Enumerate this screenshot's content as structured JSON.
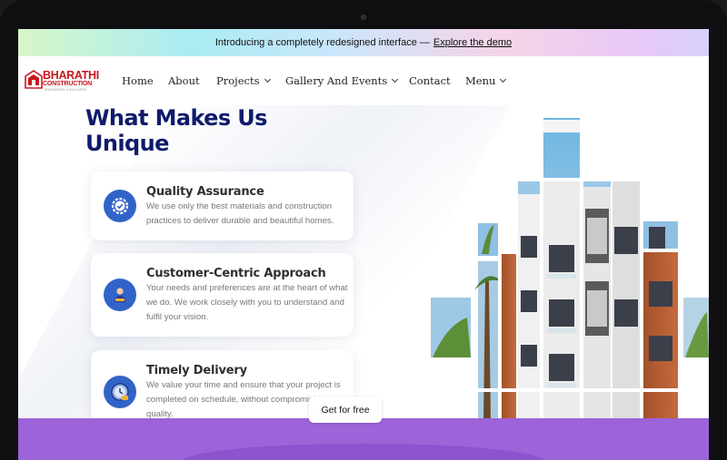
{
  "banner": {
    "text": "Introducing a completely redesigned interface —",
    "link": "Explore the demo"
  },
  "logo": {
    "name": "BHARATHI",
    "sub": "CONSTRUCTION",
    "tagline": "ENGINEERS & BUILDERS",
    "color": "#c8181e"
  },
  "nav": {
    "items": [
      {
        "label": "Home",
        "has_dropdown": false
      },
      {
        "label": "About",
        "has_dropdown": false
      },
      {
        "label": "Projects",
        "has_dropdown": true
      },
      {
        "label": "Gallery And Events",
        "has_dropdown": true
      },
      {
        "label": "Contact",
        "has_dropdown": false
      },
      {
        "label": "Menu",
        "has_dropdown": true
      }
    ]
  },
  "section": {
    "title_line1": "What Makes Us",
    "title_line2": "Unique",
    "title_color": "#0f1b6b"
  },
  "features": [
    {
      "icon": "gear-check-icon",
      "title": "Quality Assurance",
      "description": "We use only the best materials and construction practices to deliver durable and beautiful homes."
    },
    {
      "icon": "customer-icon",
      "title": "Customer-Centric Approach",
      "description": "Your needs and preferences are at the heart of what we do. We work closely with you to understand and fulfil your vision."
    },
    {
      "icon": "clock-icon",
      "title": "Timely Delivery",
      "description": "We value your time and ensure that your project is completed on schedule, without compromising on quality."
    }
  ],
  "footer": {
    "cta_label": "Get for free",
    "color": "#9d63d9"
  },
  "colors": {
    "accent_blue": "#3163c9"
  }
}
